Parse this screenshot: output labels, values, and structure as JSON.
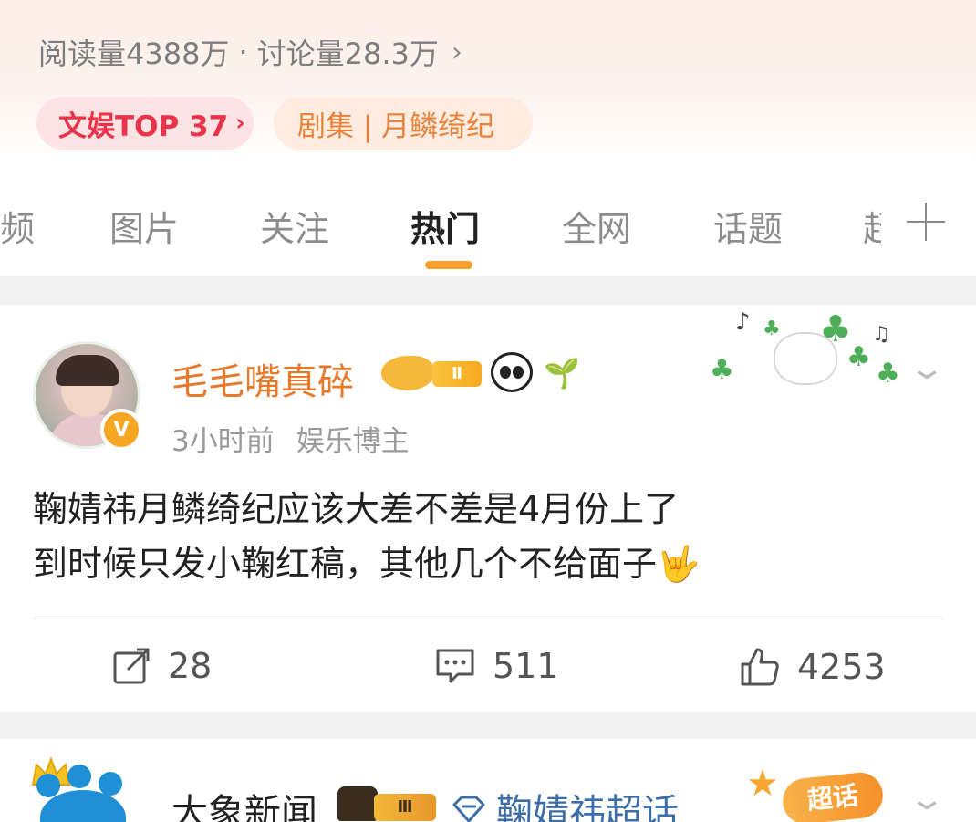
{
  "topic": {
    "stats": {
      "reads": "阅读量4388万",
      "separator": "·",
      "discussions": "讨论量28.3万",
      "chevron": "›"
    },
    "rank_chip": {
      "label": "文娱TOP 37",
      "chevron": "›"
    },
    "tag_chip": {
      "label": "剧集 | 月鳞绮纪"
    }
  },
  "tabs": {
    "items": [
      {
        "label": "频"
      },
      {
        "label": "图片"
      },
      {
        "label": "关注"
      },
      {
        "label": "热门"
      },
      {
        "label": "全网"
      },
      {
        "label": "话题"
      },
      {
        "label": "超"
      }
    ],
    "active": "热门",
    "accent_color": "#f7a12c"
  },
  "post1": {
    "username": "毛毛嘴真碎",
    "level_badge": "Ⅱ",
    "verified_badge": "V",
    "time": "3小时前",
    "role": "娱乐博主",
    "text_line1": "鞠婧祎月鳞绮纪应该大差不差是4月份上了",
    "text_line2": "到时候只发小鞠红稿，其他几个不给面子🤟",
    "actions": {
      "shares": "28",
      "comments": "511",
      "likes": "4253"
    },
    "name_color": "#e8782a"
  },
  "post2": {
    "username": "大象新闻",
    "level_badge": "Ⅲ",
    "supertopic": "鞠婧祎超话",
    "super_badge": "超话",
    "link_color": "#3e6ea8"
  }
}
